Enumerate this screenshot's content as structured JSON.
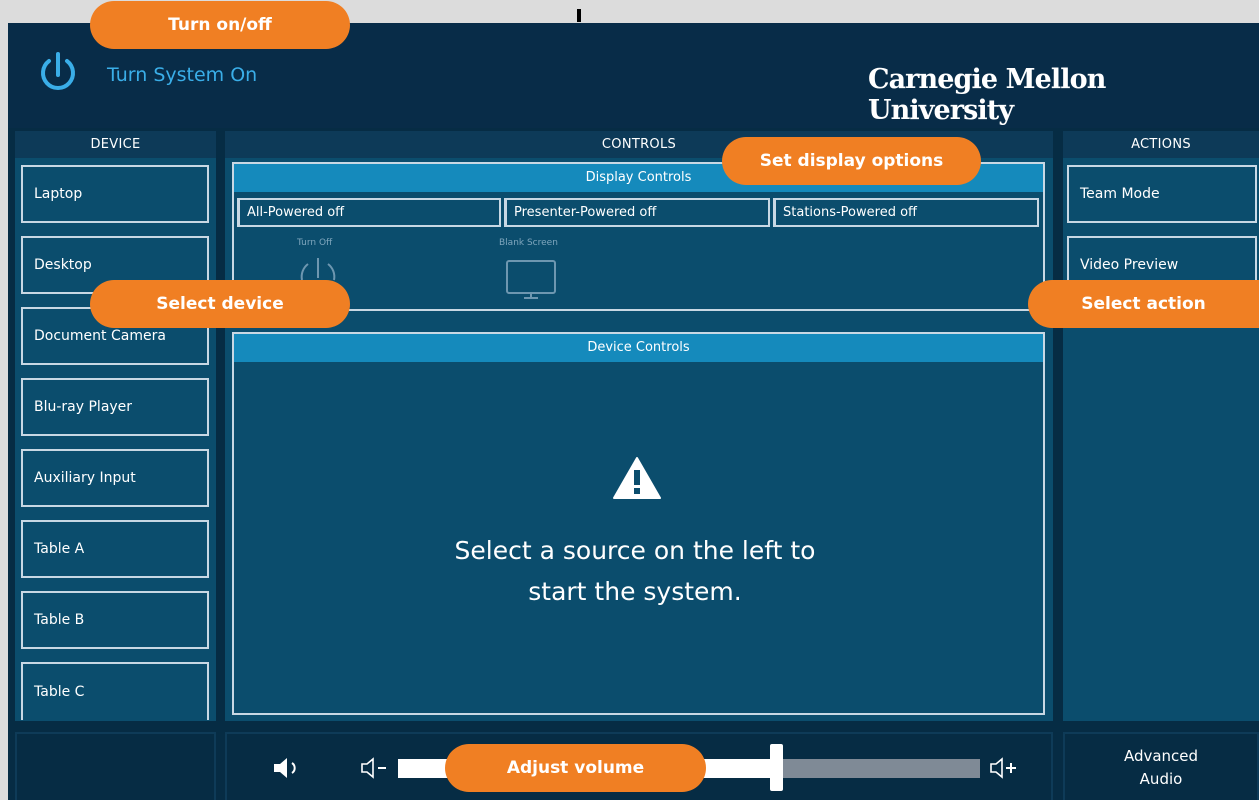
{
  "header": {
    "power_label": "Turn System On",
    "brand": "Carnegie Mellon University"
  },
  "columns": {
    "device": "DEVICE",
    "controls": "CONTROLS",
    "actions": "ACTIONS"
  },
  "devices": [
    "Laptop",
    "Desktop",
    "Document Camera",
    "Blu-ray Player",
    "Auxiliary Input",
    "Table A",
    "Table B",
    "Table C"
  ],
  "actions": [
    "Team Mode",
    "Video Preview"
  ],
  "display_controls": {
    "title": "Display Controls",
    "states": [
      "All-Powered off",
      "Presenter-Powered off",
      "Stations-Powered off"
    ],
    "turn_off_caption": "Turn Off",
    "blank_screen_caption": "Blank Screen"
  },
  "device_controls": {
    "title": "Device Controls",
    "message_line1": "Select a source on the left to",
    "message_line2": "start the system."
  },
  "audio": {
    "advanced_line1": "Advanced",
    "advanced_line2": "Audio",
    "volume_level": 0.65
  },
  "callouts": {
    "power": "Turn on/off",
    "display": "Set display options",
    "device": "Select device",
    "action": "Select action",
    "volume": "Adjust volume"
  },
  "colors": {
    "accent_blue": "#3aaee8",
    "panel_header": "#158abc",
    "callout_orange": "#f07f23",
    "background": "#062c44"
  },
  "icons": {
    "power": "power-icon",
    "display_power": "display-power-icon",
    "blank_screen": "monitor-icon",
    "warning": "warning-icon",
    "speaker": "speaker-icon",
    "volume_down": "volume-down-icon",
    "volume_up": "volume-up-icon"
  }
}
